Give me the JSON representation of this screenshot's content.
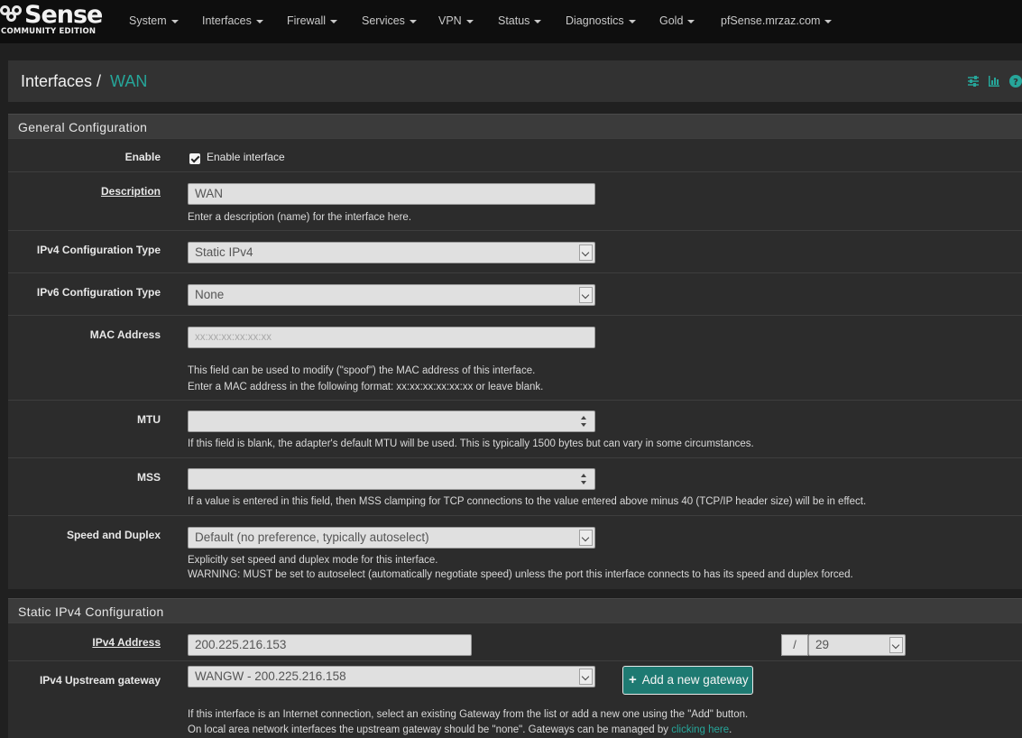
{
  "brand": {
    "logo_text": "Sense",
    "edition": "COMMUNITY EDITION"
  },
  "nav": {
    "items": [
      "System",
      "Interfaces",
      "Firewall",
      "Services",
      "VPN",
      "Status",
      "Diagnostics",
      "Gold",
      "pfSense.mrzaz.com"
    ]
  },
  "breadcrumb": {
    "parent": "Interfaces /",
    "current": "WAN"
  },
  "header_icons": [
    "sliders-icon",
    "bar-chart-icon",
    "help-icon"
  ],
  "general": {
    "title": "General Configuration",
    "enable": {
      "label": "Enable",
      "checked": true,
      "text": "Enable interface"
    },
    "description": {
      "label": "Description",
      "value": "WAN",
      "help": "Enter a description (name) for the interface here."
    },
    "ipv4_type": {
      "label": "IPv4 Configuration Type",
      "value": "Static IPv4"
    },
    "ipv6_type": {
      "label": "IPv6 Configuration Type",
      "value": "None"
    },
    "mac": {
      "label": "MAC Address",
      "placeholder": "xx:xx:xx:xx:xx:xx",
      "help1": "This field can be used to modify (\"spoof\") the MAC address of this interface.",
      "help2": "Enter a MAC address in the following format: xx:xx:xx:xx:xx:xx or leave blank."
    },
    "mtu": {
      "label": "MTU",
      "value": "",
      "help": "If this field is blank, the adapter's default MTU will be used. This is typically 1500 bytes but can vary in some circumstances."
    },
    "mss": {
      "label": "MSS",
      "value": "",
      "help": "If a value is entered in this field, then MSS clamping for TCP connections to the value entered above minus 40 (TCP/IP header size) will be in effect."
    },
    "speed": {
      "label": "Speed and Duplex",
      "value": "Default (no preference, typically autoselect)",
      "help1": "Explicitly set speed and duplex mode for this interface.",
      "help2": "WARNING: MUST be set to autoselect (automatically negotiate speed) unless the port this interface connects to has its speed and duplex forced."
    }
  },
  "static_ipv4": {
    "title": "Static IPv4 Configuration",
    "address": {
      "label": "IPv4 Address",
      "value": "200.225.216.153",
      "slash": "/",
      "mask": "29"
    },
    "gateway": {
      "label": "IPv4 Upstream gateway",
      "value": "WANGW - 200.225.216.158",
      "add_button": "Add a new gateway",
      "help1": "If this interface is an Internet connection, select an existing Gateway from the list or add a new one using the \"Add\" button.",
      "help2_pre": "On local area network interfaces the upstream gateway should be \"none\". Gateways can be managed by ",
      "help2_link": "clicking here",
      "help2_post": "."
    }
  }
}
